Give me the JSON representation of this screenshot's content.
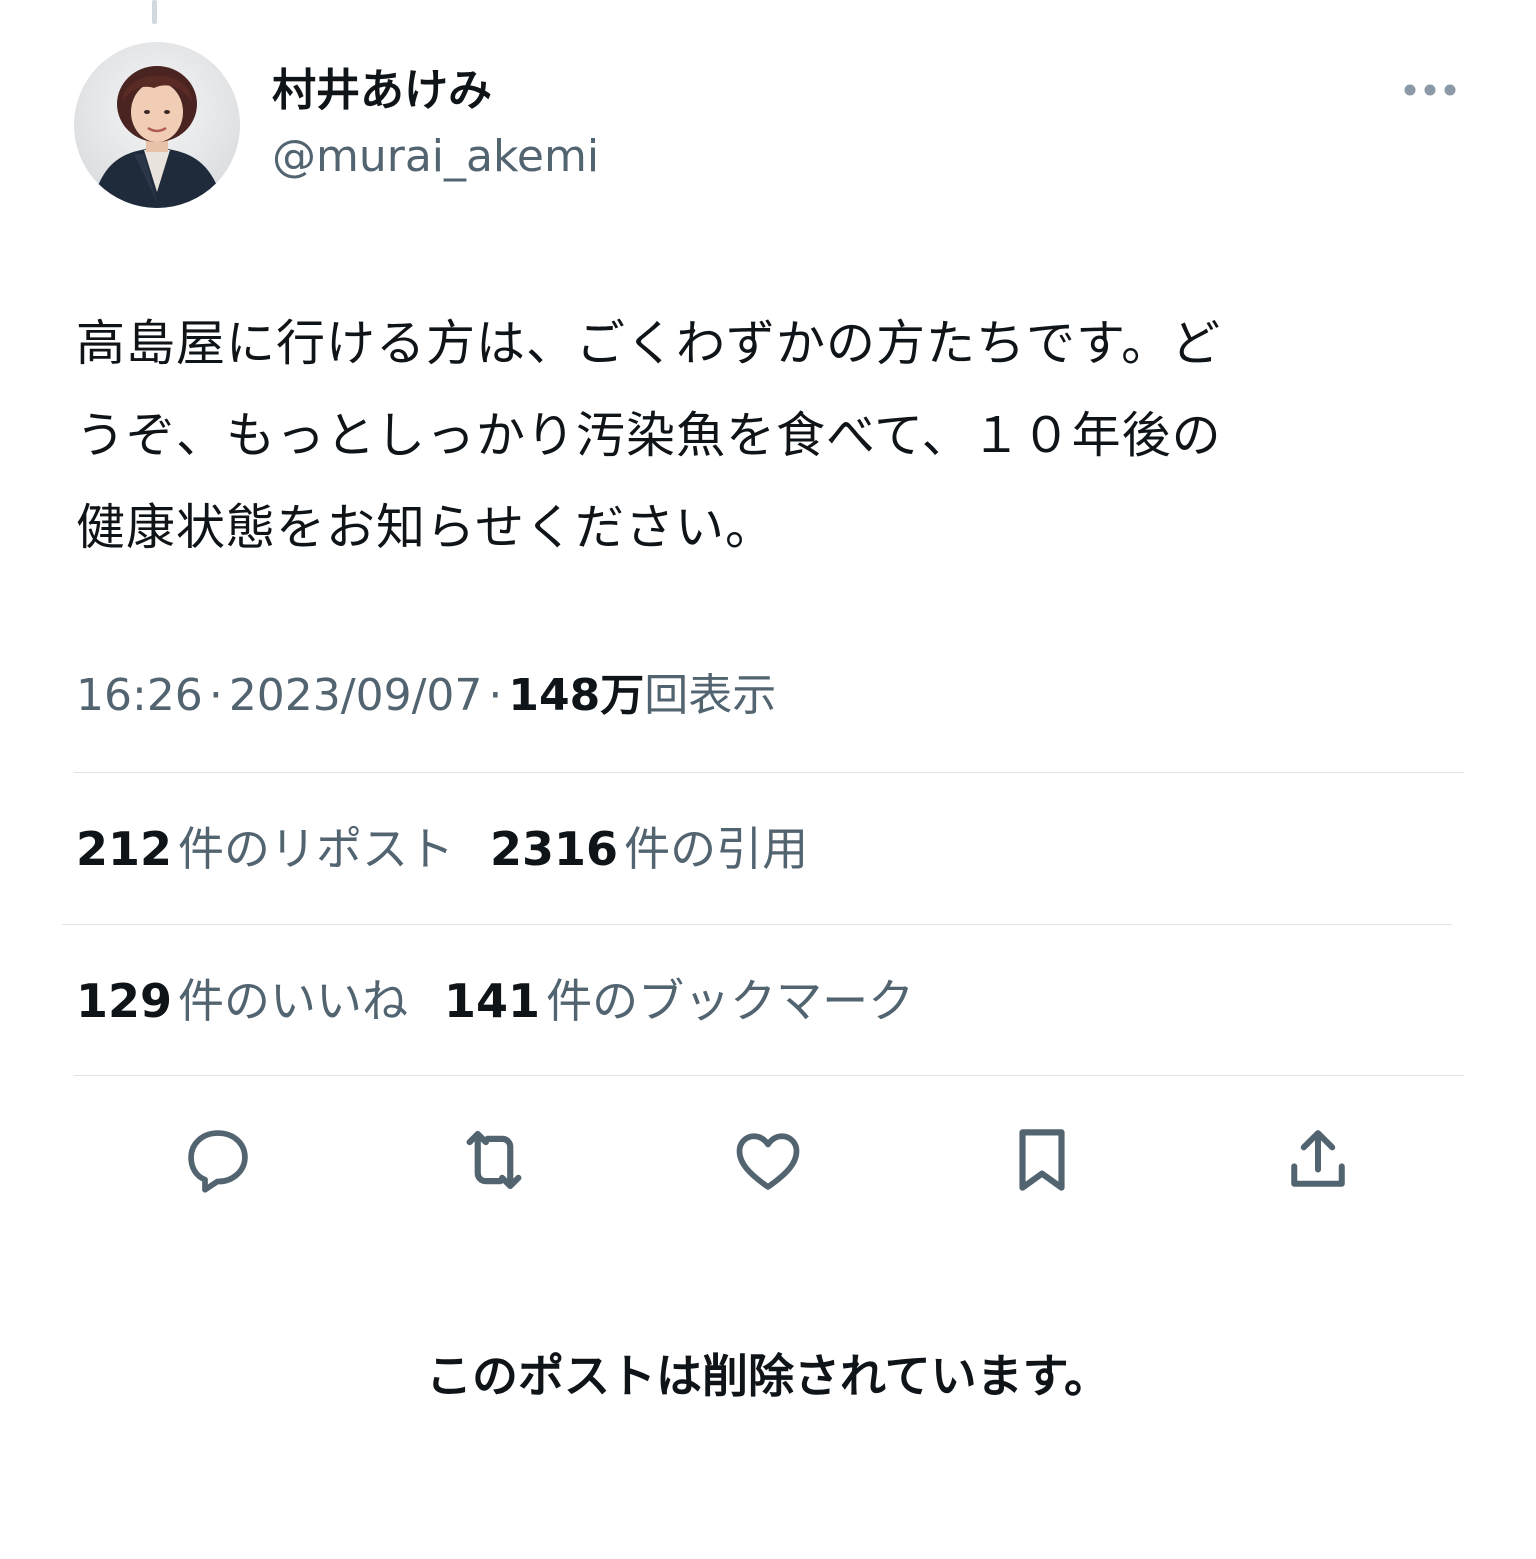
{
  "author": {
    "display_name": "村井あけみ",
    "handle": "@murai_akemi",
    "avatar_icon": "profile-photo"
  },
  "more_icon": "ellipsis-icon",
  "post": {
    "text": "高島屋に行ける方は、ごくわずかの方たちです。ど\nうぞ、もっとしっかり汚染魚を食べて、１０年後の\n健康状態をお知らせください。"
  },
  "meta": {
    "time": "16:26",
    "separator": "·",
    "date": "2023/09/07",
    "views_count": "148万",
    "views_label": "回表示"
  },
  "stats": {
    "reposts_count": "212",
    "reposts_label": "件のリポスト",
    "quotes_count": "2316",
    "quotes_label": "件の引用",
    "likes_count": "129",
    "likes_label": "件のいいね",
    "bookmarks_count": "141",
    "bookmarks_label": "件のブックマーク"
  },
  "actions": [
    {
      "icon": "reply-icon"
    },
    {
      "icon": "repost-icon"
    },
    {
      "icon": "like-icon"
    },
    {
      "icon": "bookmark-icon"
    },
    {
      "icon": "share-icon"
    }
  ],
  "colors": {
    "text_primary": "#0f1419",
    "text_secondary": "#536471",
    "divider": "#dfe3e6"
  },
  "notice": "このポストは削除されています。"
}
